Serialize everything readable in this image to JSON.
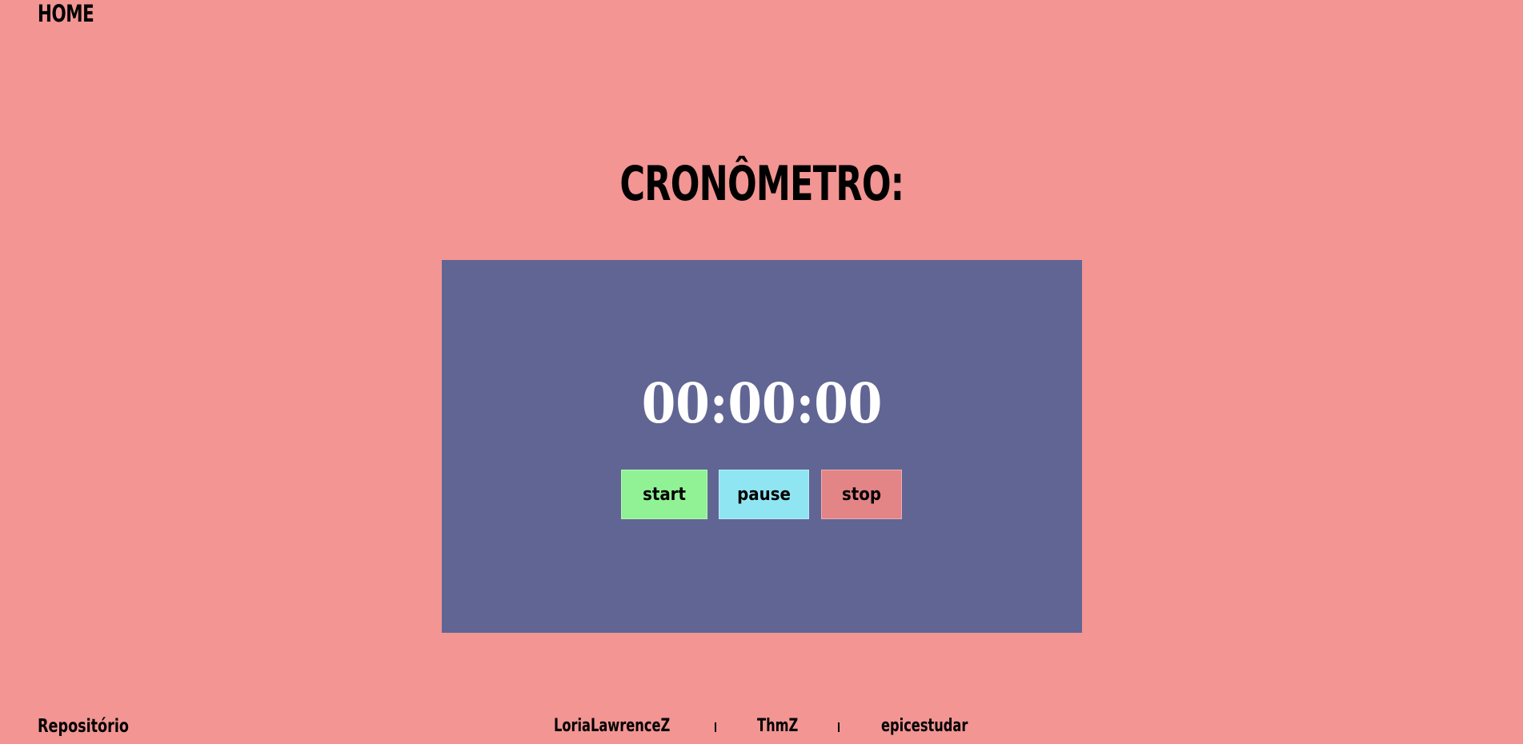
{
  "nav": {
    "home_label": "HOME"
  },
  "main": {
    "title": "CRONÔMETRO:",
    "timer": {
      "display": "00:00:00",
      "buttons": {
        "start_label": "start",
        "pause_label": "pause",
        "stop_label": "stop"
      }
    }
  },
  "footer": {
    "repo_label": "Repositório",
    "authors": [
      "LoriaLawrenceZ",
      "ThmZ",
      "epicestudar"
    ]
  },
  "colors": {
    "background": "#f29593",
    "panel": "#616594",
    "start_button": "#90f294",
    "pause_button": "#90e5f2",
    "stop_button": "#e38486",
    "timer_text": "#ffffff"
  }
}
